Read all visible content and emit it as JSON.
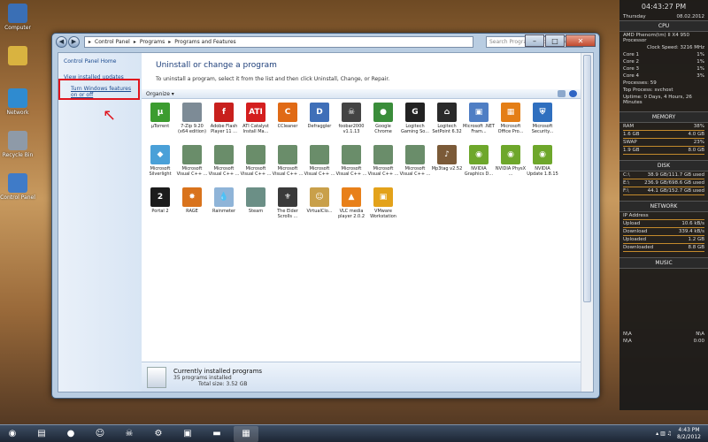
{
  "desktop": {
    "icons": [
      {
        "label": "Computer",
        "icon": "computer-icon",
        "color": "#3a6fb5"
      },
      {
        "label": "",
        "icon": "folder-icon",
        "color": "#d9b340"
      },
      {
        "label": "Network",
        "icon": "network-icon",
        "color": "#2f8bd0"
      },
      {
        "label": "Recycle Bin",
        "icon": "recycle-bin-icon",
        "color": "#8e9aa8"
      },
      {
        "label": "Control Panel",
        "icon": "control-panel-icon",
        "color": "#3f7bc8"
      }
    ]
  },
  "window": {
    "address": [
      "Control Panel",
      "Programs",
      "Programs and Features"
    ],
    "search_placeholder": "Search Programs and Features",
    "sidebar": {
      "home": "Control Panel Home",
      "installed_updates": "View installed updates",
      "windows_features": "Turn Windows features on or off"
    },
    "heading": "Uninstall or change a program",
    "subheading": "To uninstall a program, select it from the list and then click Uninstall, Change, or Repair.",
    "toolbar": {
      "organize": "Organize"
    },
    "apps": [
      {
        "name": "µTorrent",
        "glyph": "µ",
        "color": "#3c9c2f"
      },
      {
        "name": "7-Zip 9.20 (x64 edition)",
        "glyph": "",
        "color": "#7d8b96"
      },
      {
        "name": "Adobe Flash Player 11 ...",
        "glyph": "f",
        "color": "#c8201d"
      },
      {
        "name": "ATI Catalyst Install Ma...",
        "glyph": "ATI",
        "color": "#d41f1f"
      },
      {
        "name": "CCleaner",
        "glyph": "C",
        "color": "#e06a16"
      },
      {
        "name": "Defraggler",
        "glyph": "D",
        "color": "#3f6fb8"
      },
      {
        "name": "foobar2000 v1.1.13",
        "glyph": "☠",
        "color": "#444444"
      },
      {
        "name": "Google Chrome",
        "glyph": "●",
        "color": "#3a8d3a"
      },
      {
        "name": "Logitech Gaming So...",
        "glyph": "G",
        "color": "#222222"
      },
      {
        "name": "Logitech SetPoint 6.32",
        "glyph": "⌂",
        "color": "#2a2a2a"
      },
      {
        "name": "Microsoft .NET Fram...",
        "glyph": "▣",
        "color": "#4f7ec4"
      },
      {
        "name": "Microsoft Office Pro...",
        "glyph": "▦",
        "color": "#e47e16"
      },
      {
        "name": "Microsoft Security...",
        "glyph": "⛨",
        "color": "#2f6fbf"
      },
      {
        "name": "Microsoft Silverlight",
        "glyph": "◆",
        "color": "#4aa0d8"
      },
      {
        "name": "Microsoft Visual C++ ...",
        "glyph": "",
        "color": "#6a8d6a"
      },
      {
        "name": "Microsoft Visual C++ ...",
        "glyph": "",
        "color": "#6a8d6a"
      },
      {
        "name": "Microsoft Visual C++ ...",
        "glyph": "",
        "color": "#6a8d6a"
      },
      {
        "name": "Microsoft Visual C++ ...",
        "glyph": "",
        "color": "#6a8d6a"
      },
      {
        "name": "Microsoft Visual C++ ...",
        "glyph": "",
        "color": "#6a8d6a"
      },
      {
        "name": "Microsoft Visual C++ ...",
        "glyph": "",
        "color": "#6a8d6a"
      },
      {
        "name": "Microsoft Visual C++ ...",
        "glyph": "",
        "color": "#6a8d6a"
      },
      {
        "name": "Microsoft Visual C++ ...",
        "glyph": "",
        "color": "#6a8d6a"
      },
      {
        "name": "Mp3tag v2.52",
        "glyph": "♪",
        "color": "#7b5a38"
      },
      {
        "name": "NVIDIA Graphics D...",
        "glyph": "◉",
        "color": "#6ea72b"
      },
      {
        "name": "NVIDIA PhysX ...",
        "glyph": "◉",
        "color": "#6ea72b"
      },
      {
        "name": "NVIDIA Update 1.8.15",
        "glyph": "◉",
        "color": "#6ea72b"
      },
      {
        "name": "Portal 2",
        "glyph": "2",
        "color": "#1c1c1c"
      },
      {
        "name": "RAGE",
        "glyph": "✸",
        "color": "#d9731c"
      },
      {
        "name": "Rainmeter",
        "glyph": "💧",
        "color": "#8fb4d8"
      },
      {
        "name": "Steam",
        "glyph": "",
        "color": "#6b8f86"
      },
      {
        "name": "The Elder Scrolls ...",
        "glyph": "⚜",
        "color": "#3a3a3a"
      },
      {
        "name": "VirtualClo...",
        "glyph": "☺",
        "color": "#c9a04a"
      },
      {
        "name": "VLC media player 2.0.2",
        "glyph": "▲",
        "color": "#e8801a"
      },
      {
        "name": "VMware Workstation",
        "glyph": "▣",
        "color": "#e3a21a"
      }
    ],
    "status": {
      "title": "Currently installed programs",
      "count": "35 programs installed",
      "total": "Total size: 3.52 GB"
    }
  },
  "gadgets": {
    "time": "04:43:27 PM",
    "day": "Thursday",
    "date": "08.02.2012",
    "cpu": {
      "title": "CPU",
      "model": "AMD Phenom(tm) II X4 950 Processor",
      "clock": "Clock Speed: 3216 MHz",
      "cores": [
        {
          "name": "Core 1",
          "value": "1%"
        },
        {
          "name": "Core 2",
          "value": "1%"
        },
        {
          "name": "Core 3",
          "value": "1%"
        },
        {
          "name": "Core 4",
          "value": "3%"
        }
      ],
      "processes": "Processes: 59",
      "top": "Top Process: svchost",
      "uptime": "Uptime: 0 Days, 4 Hours, 26 Minutes"
    },
    "memory": {
      "title": "MEMORY",
      "rows": [
        {
          "name": "RAM",
          "value": "38%"
        },
        {
          "name": "1.6 GB",
          "value": "4.0 GB"
        },
        {
          "name": "SWAP",
          "value": "23%"
        },
        {
          "name": "1.9 GB",
          "value": "8.0 GB"
        }
      ]
    },
    "disk": {
      "title": "DISK",
      "rows": [
        {
          "name": "C:\\",
          "value": "38.9 GB/111.7 GB used"
        },
        {
          "name": "E:\\",
          "value": "236.9 GB/698.6 GB used"
        },
        {
          "name": "F:\\",
          "value": "44.1 GB/152.7 GB used"
        }
      ]
    },
    "network": {
      "title": "NETWORK",
      "rows": [
        {
          "name": "IP Address",
          "value": ""
        },
        {
          "name": "Upload",
          "value": "10.6 kB/s"
        },
        {
          "name": "Download",
          "value": "339.4 kB/s"
        },
        {
          "name": "Uploaded",
          "value": "1.2 GB"
        },
        {
          "name": "Downloaded",
          "value": "8.8 GB"
        }
      ]
    },
    "music": {
      "title": "MUSIC",
      "rows": [
        {
          "name": "N\\A",
          "value": "N\\A"
        },
        {
          "name": "N\\A",
          "value": "0:00"
        }
      ]
    }
  },
  "taskbar": {
    "items": [
      {
        "icon": "start-orb-icon",
        "glyph": "◉"
      },
      {
        "icon": "explorer-icon",
        "glyph": "▤"
      },
      {
        "icon": "chrome-icon",
        "glyph": "●"
      },
      {
        "icon": "smiley-app-icon",
        "glyph": "☺"
      },
      {
        "icon": "foobar-icon",
        "glyph": "☠"
      },
      {
        "icon": "steam-icon",
        "glyph": "⚙"
      },
      {
        "icon": "vmware-icon",
        "glyph": "▣"
      },
      {
        "icon": "console-icon",
        "glyph": "▬"
      },
      {
        "icon": "control-panel-icon",
        "glyph": "▦"
      }
    ],
    "time": "4:43 PM",
    "date": "8/2/2012"
  }
}
